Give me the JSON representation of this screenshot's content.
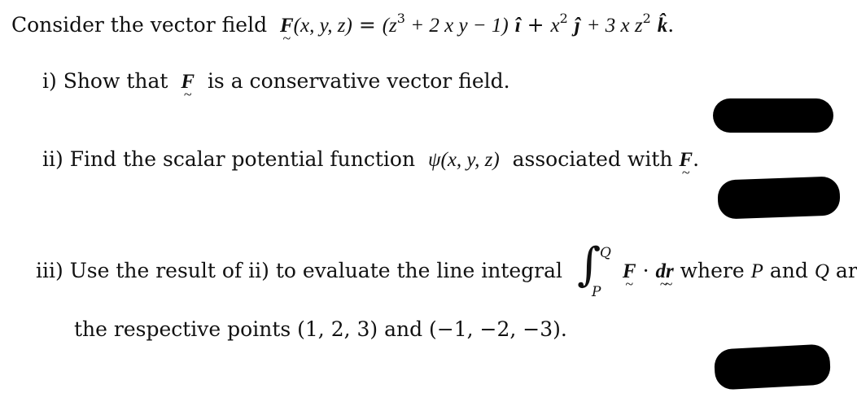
{
  "intro": {
    "text": "Consider the vector field",
    "field_name": "F",
    "args": "(x, y, z)",
    "equals": "=",
    "comp_i_open": "(z",
    "comp_i_exp": "3",
    "comp_i_rest": " + 2 x y − 1)",
    "unit_i": "î",
    "plus1": "+",
    "comp_j": "x",
    "comp_j_exp": "2",
    "unit_j": "ĵ",
    "comp_k": "+ 3 x z",
    "comp_k_exp": "2",
    "unit_k": "k̂",
    "period": "."
  },
  "parts": [
    {
      "label": "i)",
      "text_before": "Show that",
      "symbol": "F",
      "text_after": "is a conservative vector field."
    },
    {
      "label": "ii)",
      "text_before": "Find the scalar potential function",
      "function": "ψ(x, y, z)",
      "text_middle": "associated with",
      "symbol": "F",
      "text_after": "."
    },
    {
      "label": "iii)",
      "text_before": "Use the result of ii) to evaluate the line integral",
      "integral_upper": "Q",
      "integral_lower": "P",
      "integrand_f": "F",
      "dot": "·",
      "integrand_dr": "dr",
      "text_middle": "where",
      "point_p": "P",
      "and": "and",
      "point_q": "Q",
      "text_after": "are",
      "continuation": "the respective points (1, 2, 3) and (−1, −2, −3)."
    }
  ],
  "redactions": {
    "count": 3,
    "color": "#000000"
  }
}
